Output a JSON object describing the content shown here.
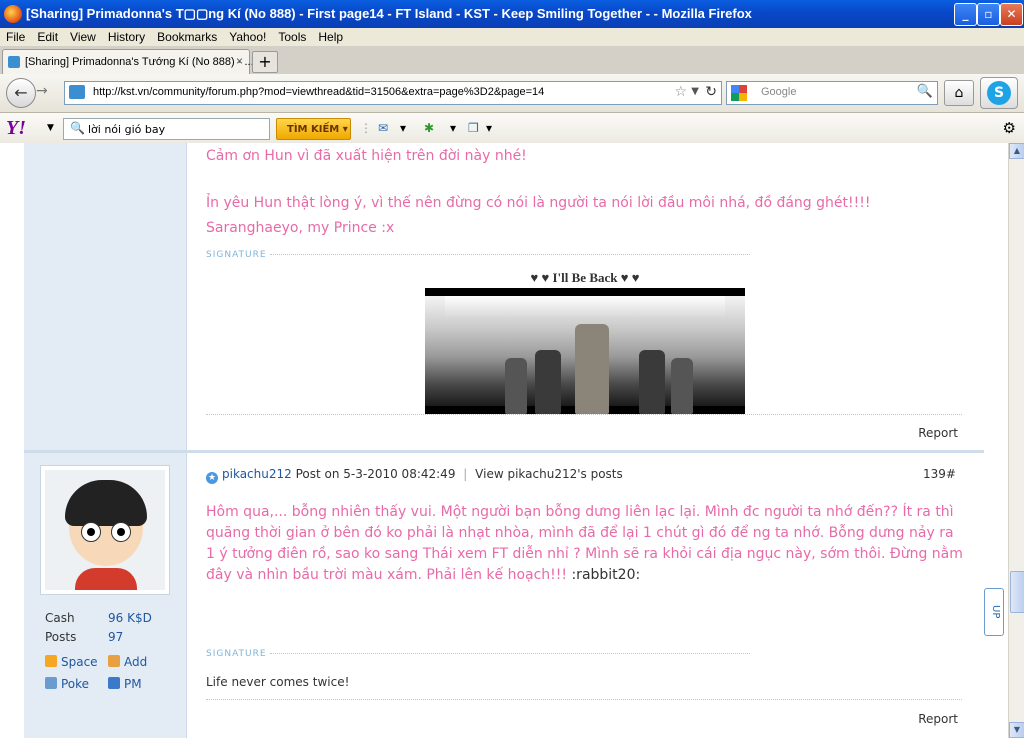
{
  "window": {
    "title": "[Sharing] Primadonna's T▢▢ng Kí (No 888) - First page14 - FT Island - KST - Keep Smiling Together - - Mozilla Firefox",
    "minimize": "_",
    "maximize": "▫",
    "close": "✕"
  },
  "menu": [
    "File",
    "Edit",
    "View",
    "History",
    "Bookmarks",
    "Yahoo!",
    "Tools",
    "Help"
  ],
  "tab": {
    "label": "[Sharing] Primadonna's Tướng Kí (No 888) - ...",
    "close": "×",
    "new_tab": "+"
  },
  "nav": {
    "url": "http://kst.vn/community/forum.php?mod=viewthread&tid=31506&extra=page%3D2&page=14",
    "search_placeholder": "Google"
  },
  "yahoo": {
    "logo": "Y!",
    "search_value": "lời nói gió bay",
    "search_button": "TÌM KIẾM"
  },
  "post1": {
    "line1": "Cảm ơn Hun vì đã xuất hiện trên đời này nhé!",
    "line2": "Ỉn yêu Hun thật lòng ý, vì thế nên đừng có nói là người ta nói lời đầu môi nhá, đồ đáng ghét!!!!",
    "line3": "Saranghaeyo, my Prince :x",
    "signature_label": "SIGNATURE",
    "sig_title": "♥ ♥ I'll Be Back ♥ ♥",
    "report": "Report"
  },
  "post2": {
    "author": "pikachu212",
    "posted_on": "Post on 5-3-2010 08:42:49",
    "divider": "|",
    "view_posts": "View pikachu212's posts",
    "number": "139#",
    "body": "Hôm qua,... bỗng nhiên thấy vui. Một người bạn bỗng dưng liên lạc lại. Mình đc người ta nhớ đến?? Ít ra thì quãng thời gian ở bên đó ko phải là nhạt nhòa, mình đã để lại 1 chút gì đó để ng ta nhớ. Bỗng dưng nảy ra 1 ý tưởng điên rồ, sao ko sang Thái xem FT diễn nhỉ ? Mình sẽ ra khỏi cái địa ngục này, sớm thôi. Đừng nằm đây và nhìn bầu trời màu xám. Phải lên kế hoạch!!! ",
    "smiley": ":rabbit20:",
    "signature_label": "SIGNATURE",
    "signature": "Life never comes twice!",
    "report": "Report"
  },
  "user": {
    "cash_label": "Cash",
    "cash_value": "96 K$D",
    "posts_label": "Posts",
    "posts_value": "97",
    "space": "Space",
    "add": "Add",
    "poke": "Poke",
    "pm": "PM"
  },
  "up_button": "UP"
}
